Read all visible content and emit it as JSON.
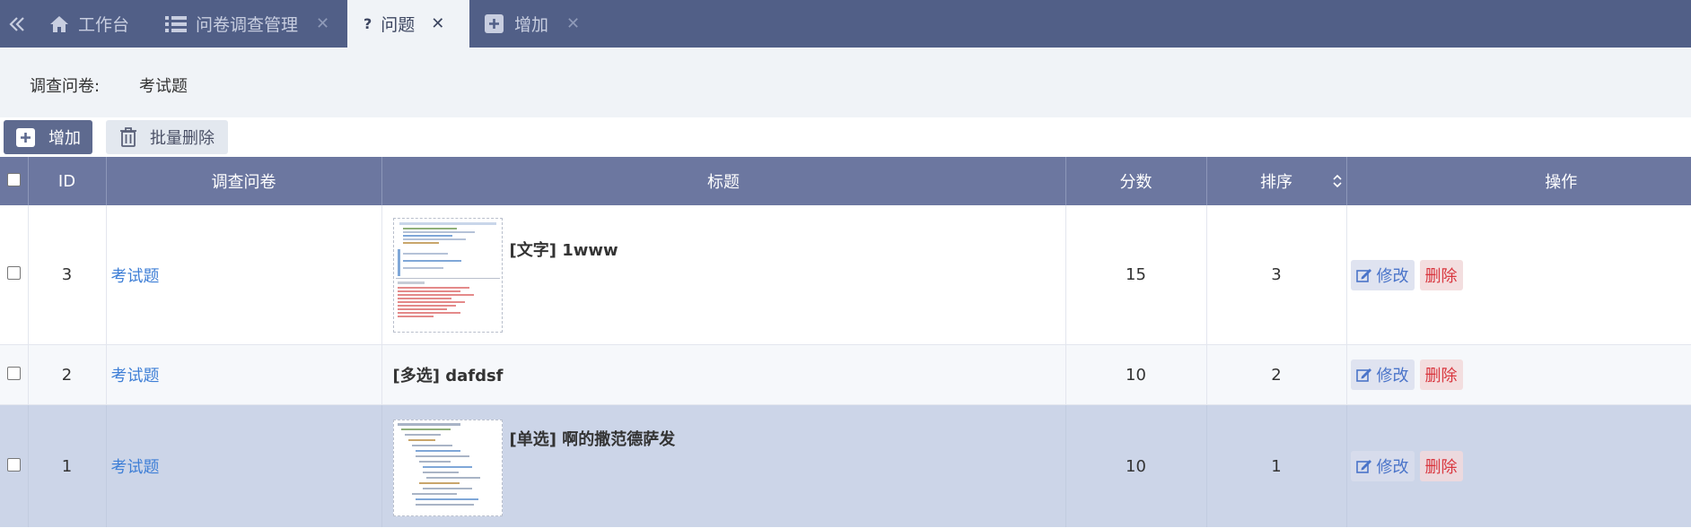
{
  "tabs": [
    {
      "label": "工作台",
      "icon": "home-icon",
      "closable": false
    },
    {
      "label": "问卷调查管理",
      "icon": "list-icon",
      "closable": true
    },
    {
      "label": "问题",
      "icon": "question-icon",
      "closable": true,
      "active": true
    },
    {
      "label": "增加",
      "icon": "plus-square-icon",
      "closable": true
    }
  ],
  "filter": {
    "label": "调查问卷:",
    "value": "考试题"
  },
  "toolbar": {
    "add_label": "增加",
    "batch_delete_label": "批量删除"
  },
  "table": {
    "headers": {
      "id": "ID",
      "survey": "调查问卷",
      "title": "标题",
      "score": "分数",
      "order": "排序",
      "actions": "操作"
    },
    "rows": [
      {
        "id": "3",
        "survey": "考试题",
        "title": "[文字] 1www",
        "has_image": true,
        "score": "15",
        "order": "3"
      },
      {
        "id": "2",
        "survey": "考试题",
        "title": "[多选] dafdsf",
        "has_image": false,
        "score": "10",
        "order": "2"
      },
      {
        "id": "1",
        "survey": "考试题",
        "title": "[单选] 啊的撒范德萨发",
        "has_image": true,
        "score": "10",
        "order": "1"
      }
    ],
    "edit_label": "修改",
    "delete_label": "删除"
  },
  "colors": {
    "tabbar": "#515f87",
    "header": "#6c77a0",
    "link": "#3f7fd6",
    "delete": "#d9363e",
    "selected_row": "#ccd5e8"
  }
}
